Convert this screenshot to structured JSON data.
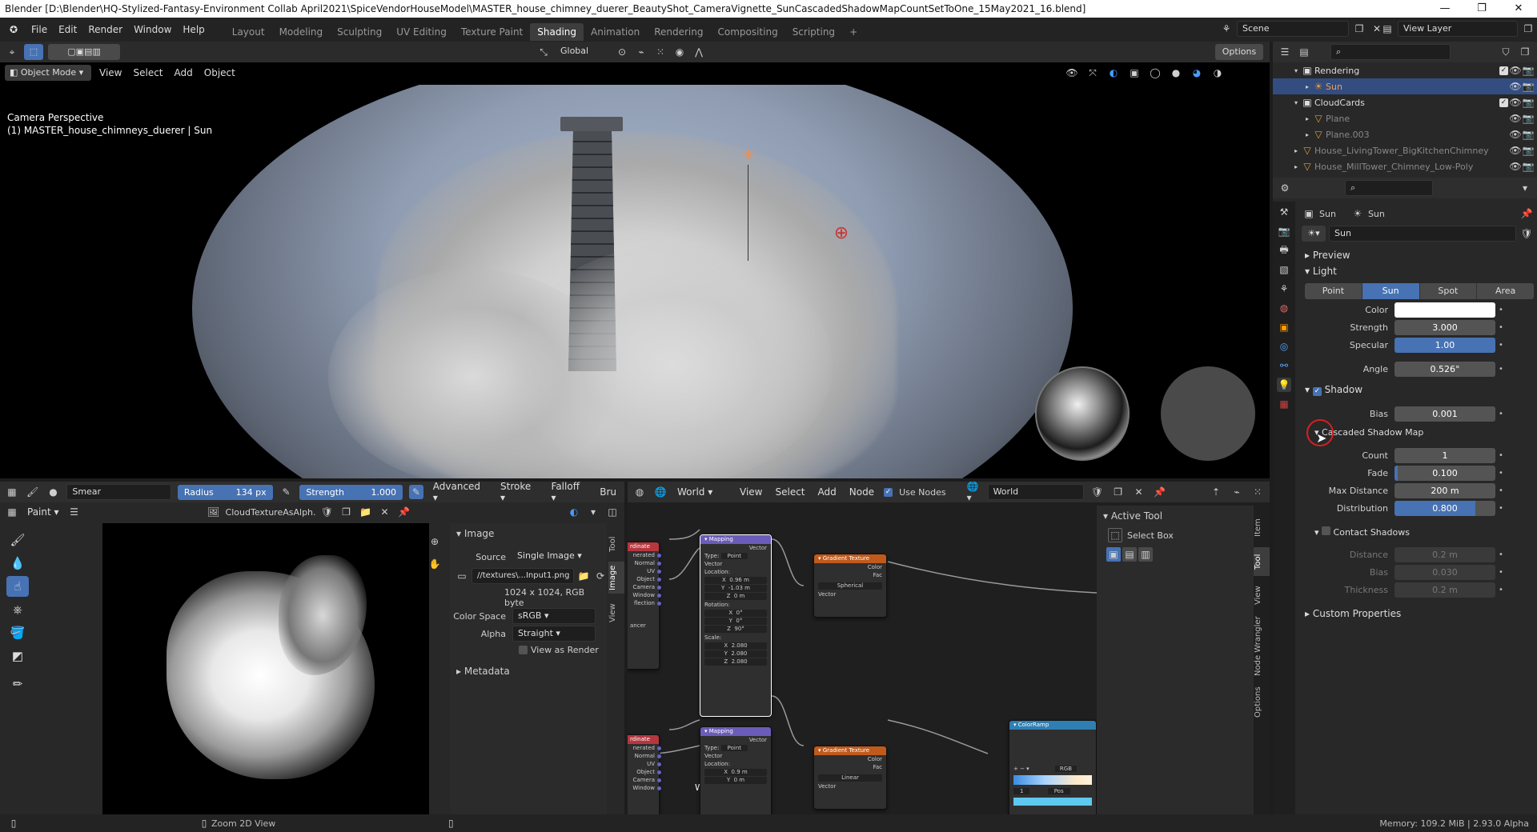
{
  "window": {
    "title": "Blender [D:\\Blender\\HQ-Stylized-Fantasy-Environment Collab April2021\\SpiceVendorHouseModel\\MASTER_house_chimney_duerer_BeautyShot_CameraVignette_SunCascadedShadowMapCountSetToOne_15May2021_16.blend]",
    "controls": [
      "—",
      "❐",
      "✕"
    ]
  },
  "menu": [
    "File",
    "Edit",
    "Render",
    "Window",
    "Help"
  ],
  "workspaces": [
    "Layout",
    "Modeling",
    "Sculpting",
    "UV Editing",
    "Texture Paint",
    "Shading",
    "Animation",
    "Rendering",
    "Compositing",
    "Scripting"
  ],
  "active_workspace": "Shading",
  "scene": {
    "name": "Scene",
    "view_layer": "View Layer"
  },
  "viewport": {
    "mode": "Object Mode",
    "menus": [
      "View",
      "Select",
      "Add",
      "Object"
    ],
    "transform": "Global",
    "options": "Options",
    "overlay_line1": "Camera Perspective",
    "overlay_line2": "(1) MASTER_house_chimneys_duerer | Sun"
  },
  "outliner": {
    "rows": [
      {
        "name": "Rendering",
        "indent": 1,
        "type": "collection"
      },
      {
        "name": "Sun",
        "indent": 2,
        "type": "light",
        "selected": true
      },
      {
        "name": "CloudCards",
        "indent": 1,
        "type": "collection"
      },
      {
        "name": "Plane",
        "indent": 2,
        "type": "mesh",
        "dim": true
      },
      {
        "name": "Plane.003",
        "indent": 2,
        "type": "mesh",
        "dim": true
      },
      {
        "name": "House_LivingTower_BigKitchenChimney",
        "indent": 1,
        "type": "mesh",
        "dim": true
      },
      {
        "name": "House_MillTower_Chimney_Low-Poly",
        "indent": 1,
        "type": "mesh",
        "dim": true
      }
    ]
  },
  "properties": {
    "breadcrumb_object": "Sun",
    "breadcrumb_data": "Sun",
    "datablock": "Sun",
    "preview": "Preview",
    "light": "Light",
    "light_types": [
      "Point",
      "Sun",
      "Spot",
      "Area"
    ],
    "active_light_type": "Sun",
    "color_label": "Color",
    "strength_label": "Strength",
    "strength": "3.000",
    "specular_label": "Specular",
    "specular": "1.00",
    "angle_label": "Angle",
    "angle": "0.526°",
    "shadow": "Shadow",
    "bias_label": "Bias",
    "bias": "0.001",
    "csm": "Cascaded Shadow Map",
    "count_label": "Count",
    "count": "1",
    "fade_label": "Fade",
    "fade": "0.100",
    "maxdist_label": "Max Distance",
    "maxdist": "200 m",
    "distribution_label": "Distribution",
    "distribution": "0.800",
    "contact": "Contact Shadows",
    "distance_label": "Distance",
    "distance": "0.2 m",
    "cbias_label": "Bias",
    "cbias": "0.030",
    "thickness_label": "Thickness",
    "thickness": "0.2 m",
    "custom": "Custom Properties",
    "fade_fraction": 0.03,
    "distribution_fraction": 0.8
  },
  "paint_header": {
    "brush": "Smear",
    "radius_label": "Radius",
    "radius": "134 px",
    "strength_label": "Strength",
    "strength": "1.000",
    "menus": [
      "Advanced",
      "Stroke",
      "Falloff",
      "Bru"
    ]
  },
  "image_editor": {
    "mode": "Paint",
    "image_name": "CloudTextureAsAlph...",
    "image_section": "Image",
    "source_label": "Source",
    "source": "Single Image",
    "filepath": "//textures\\...Input1.png",
    "info": "1024 x 1024,  RGB byte",
    "colorspace_label": "Color Space",
    "colorspace": "sRGB",
    "alpha_label": "Alpha",
    "alpha": "Straight",
    "view_as_render": "View as Render",
    "metadata": "Metadata",
    "side_tabs": [
      "Tool",
      "Image",
      "View"
    ]
  },
  "node_editor": {
    "world": "World",
    "menus": [
      "View",
      "Select",
      "Add",
      "Node"
    ],
    "use_nodes": "Use Nodes",
    "world_name": "World",
    "corner_label": "World",
    "active_tool": "Active Tool",
    "select_box": "Select Box",
    "side_tabs": [
      "Item",
      "Tool",
      "View",
      "Node Wrangler",
      "Options"
    ]
  },
  "nodes": {
    "coord_title": "rdinate",
    "coord_outputs": [
      "nerated",
      "Normal",
      "UV",
      "Object",
      "Camera",
      "Window",
      "flection"
    ],
    "coord_footer": "ancer",
    "mapping_title": "Mapping",
    "vector": "Vector",
    "type_label": "Type:",
    "type_val": "Point",
    "location": "Location:",
    "rotation": "Rotation:",
    "scale": "Scale:",
    "loc": [
      "0.96 m",
      "-1.03 m",
      "0 m"
    ],
    "rot": [
      "0°",
      "0°",
      "90°"
    ],
    "scl": [
      "2.080",
      "2.080",
      "2.080"
    ],
    "loc2": [
      "0.9 m",
      "0 m"
    ],
    "gradient_title": "Gradient Texture",
    "color": "Color",
    "fac": "Fac",
    "grad1": "Spherical",
    "grad2": "Linear",
    "colorramp": "ColorRamp",
    "ramp_mode": "RGB",
    "ramp_index": "1",
    "ramp_pos": "Pos"
  },
  "statusbar": {
    "zoom": "Zoom 2D View",
    "memory": "Memory: 109.2 MiB | 2.93.0 Alpha"
  }
}
